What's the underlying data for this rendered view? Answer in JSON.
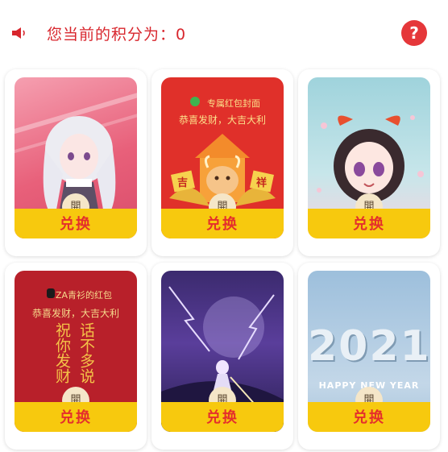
{
  "header": {
    "points_label": "您当前的积分为：0",
    "help_label": "?",
    "accent_color": "#d8262d"
  },
  "cards": [
    {
      "theme": "anime-girl-white-hair",
      "seal": "開",
      "button": "兑换"
    },
    {
      "theme": "ox-year-red",
      "cover_title": "专属红包封面",
      "cover_sub": "恭喜发财，大吉大利",
      "tag_left": "吉",
      "tag_right": "祥",
      "seal": "開",
      "button": "兑换"
    },
    {
      "theme": "anime-girl-red-bow",
      "seal": "開",
      "button": "兑换"
    },
    {
      "theme": "poem-red",
      "cover_title": "ZA青衫的红包",
      "cover_sub": "恭喜发财，大吉大利",
      "poem_right": "话不多说",
      "poem_left": "祝你发财",
      "seal": "開",
      "button": "兑换"
    },
    {
      "theme": "anime-night-purple",
      "seal": "開",
      "button": "兑换"
    },
    {
      "theme": "2021-new-year",
      "year": "2021",
      "greeting": "HAPPY NEW YEAR",
      "seal": "開",
      "button": "兑换"
    }
  ]
}
